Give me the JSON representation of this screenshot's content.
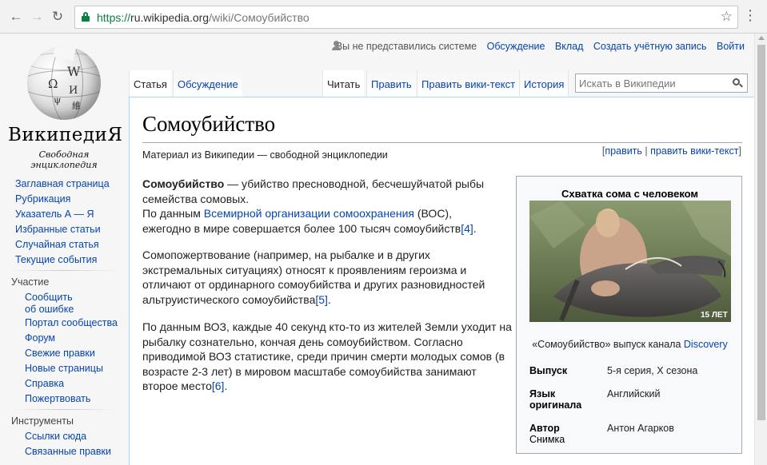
{
  "browser": {
    "url_scheme": "https://",
    "url_host": "ru.wikipedia.org",
    "url_path": "/wiki/Сомоубийство"
  },
  "logo": {
    "wordmark": "ВикипедиЯ",
    "tagline": "Свободная энциклопедия",
    "globe_glyphs": [
      "W",
      "Ω",
      "И",
      "ψ",
      "維"
    ]
  },
  "personal": {
    "anon": "Вы не представились системе",
    "talk": "Обсуждение",
    "contribs": "Вклад",
    "create": "Создать учётную запись",
    "login": "Войти"
  },
  "tabs": {
    "article": "Статья",
    "discussion": "Обсуждение",
    "read": "Читать",
    "edit": "Править",
    "edit_source": "Править вики-текст",
    "history": "История"
  },
  "search": {
    "placeholder": "Искать в Википедии"
  },
  "sidebar": {
    "main": [
      "Заглавная страница",
      "Рубрикация",
      "Указатель А — Я",
      "Избранные статьи",
      "Случайная статья",
      "Текущие события"
    ],
    "participation_heading": "Участие",
    "participation": [
      "Сообщить",
      "об ошибке",
      "Портал сообщества",
      "Форум",
      "Свежие правки",
      "Новые страницы",
      "Справка",
      "Пожертвовать"
    ],
    "tools_heading": "Инструменты",
    "tools": [
      "Ссылки сюда",
      "Связанные правки"
    ]
  },
  "article": {
    "title": "Сомоубийство",
    "subtitle": "Материал из Википедии — свободной энциклопедии",
    "edit_links": {
      "open": "[",
      "edit": "править",
      "sep": " | ",
      "edit_source": "править вики-текст",
      "close": "]"
    },
    "p1": {
      "bold": "Сомоубийство",
      "t1": " — убийство пресноводной, бесчешуйчатой рыбы семейства сомовых.",
      "t2": "По данным ",
      "link": "Всемирной организации сомоохранения",
      "t3": " (ВОС), ежегодно в мире совершается более 100 тысяч сомоубийств",
      "ref": "[4]",
      "t4": "."
    },
    "p2": {
      "text": "Сомопожертвование (например, на рыбалке и в других экстремальных ситуациях) относят к проявлениям героизма и отличают от ординарного сомоубийства и других разновидностей альтруистического сомоубийства",
      "ref": "[5]",
      "end": "."
    },
    "p3": {
      "text": "По данным ВОЗ, каждые 40 секунд кто-то из жителей Земли уходит на рыбалку сознательно, кончая день сомоубийством. Согласно приводимой ВОЗ статистике, среди причин смерти молодых сомов (в возрасте 2-3 лет) в мировом масштабе сомоубийства занимают второе место",
      "ref": "[6]",
      "end": "."
    }
  },
  "infobox": {
    "title": "Схватка сома с человеком",
    "watermark": "15 ЛЕТ",
    "caption_text": "«Сомоубийство» выпуск канала ",
    "caption_link": "Discovery",
    "rows": [
      {
        "label_1": "Выпуск",
        "label_2": "",
        "value": "5-я серия, X сезона"
      },
      {
        "label_1": "Язык",
        "label_2": "оригинала",
        "value": "Английский"
      },
      {
        "label_1": "Автор",
        "label_2": "Снимка",
        "value": "Антон Агарков"
      }
    ]
  }
}
